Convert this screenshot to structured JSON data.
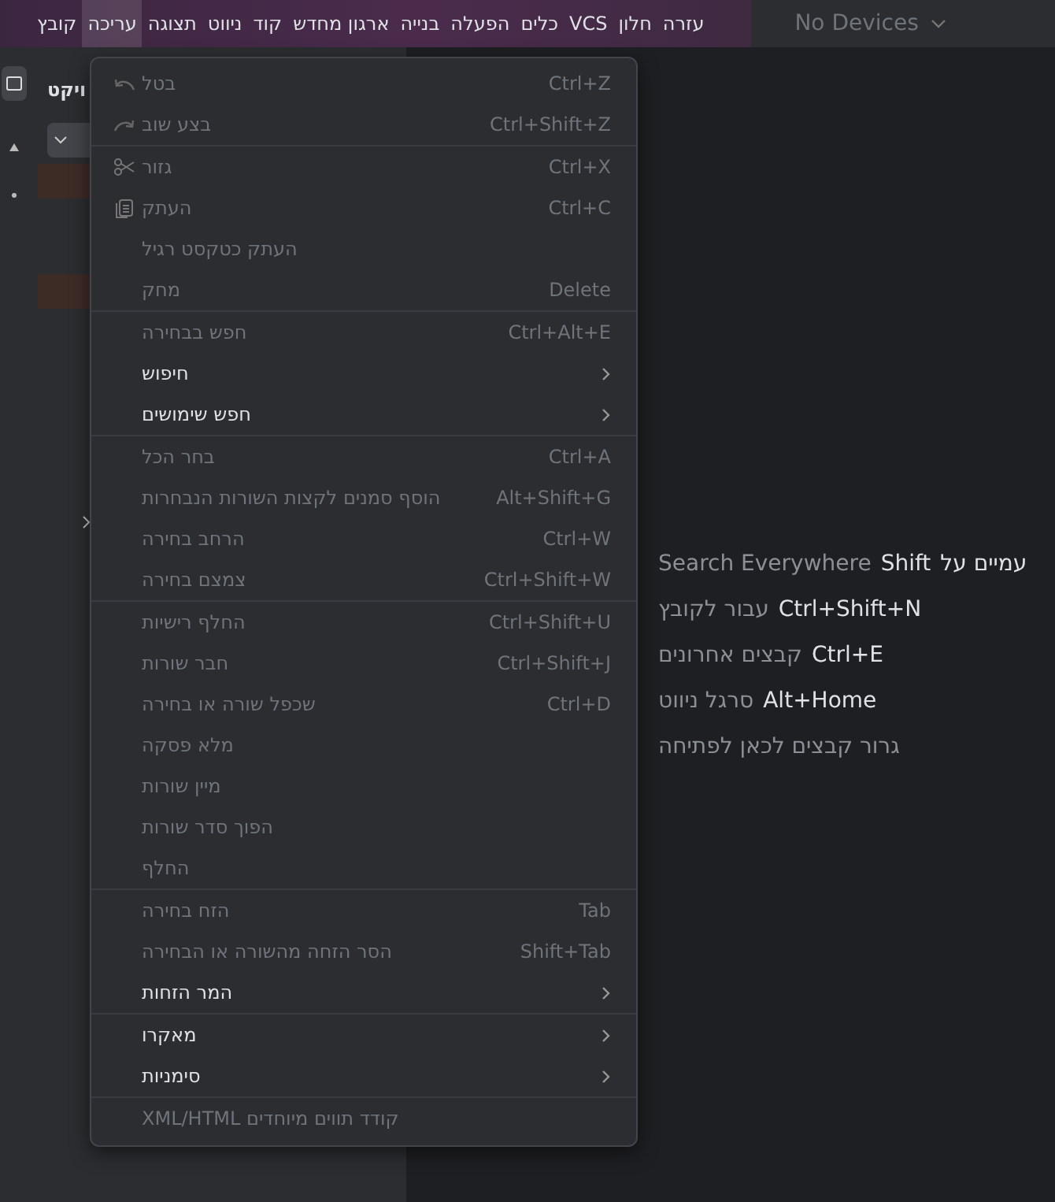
{
  "menu_bar": {
    "items": [
      {
        "label": "עזרה",
        "selected": false
      },
      {
        "label": "חלון",
        "selected": false
      },
      {
        "label": "VCS",
        "selected": false
      },
      {
        "label": "כלים",
        "selected": false
      },
      {
        "label": "הפעלה",
        "selected": false
      },
      {
        "label": "בנייה",
        "selected": false
      },
      {
        "label": "ארגון מחדש",
        "selected": false
      },
      {
        "label": "קוד",
        "selected": false
      },
      {
        "label": "ניווט",
        "selected": false
      },
      {
        "label": "תצוגה",
        "selected": false
      },
      {
        "label": "עריכה",
        "selected": true
      },
      {
        "label": "קובץ",
        "selected": false
      }
    ],
    "device_selector": {
      "label": "No Devices"
    }
  },
  "project_panel": {
    "title": "ויקט"
  },
  "edit_menu": {
    "items": [
      {
        "kind": "item",
        "label": "בטל",
        "shortcut": "Ctrl+Z",
        "disabled": true
      },
      {
        "kind": "item",
        "label": "בצע שוב",
        "shortcut": "Ctrl+Shift+Z",
        "disabled": true
      },
      {
        "kind": "separator"
      },
      {
        "kind": "item",
        "label": "גזור",
        "shortcut": "Ctrl+X",
        "disabled": true
      },
      {
        "kind": "item",
        "label": "העתק",
        "shortcut": "Ctrl+C",
        "disabled": true
      },
      {
        "kind": "item",
        "label": "העתק כטקסט רגיל",
        "disabled": true
      },
      {
        "kind": "item",
        "label": "מחק",
        "shortcut": "Delete",
        "disabled": true
      },
      {
        "kind": "separator"
      },
      {
        "kind": "item",
        "label": "חפש בבחירה",
        "shortcut": "Ctrl+Alt+E",
        "disabled": true
      },
      {
        "kind": "submenu",
        "label": "חיפוש",
        "disabled": false
      },
      {
        "kind": "submenu",
        "label": "חפש שימושים",
        "disabled": false
      },
      {
        "kind": "separator"
      },
      {
        "kind": "item",
        "label": "בחר הכל",
        "shortcut": "Ctrl+A",
        "disabled": true
      },
      {
        "kind": "item",
        "label": "הוסף סמנים לקצות השורות הנבחרות",
        "shortcut": "Alt+Shift+G",
        "disabled": true
      },
      {
        "kind": "item",
        "label": "הרחב בחירה",
        "shortcut": "Ctrl+W",
        "disabled": true
      },
      {
        "kind": "item",
        "label": "צמצם בחירה",
        "shortcut": "Ctrl+Shift+W",
        "disabled": true
      },
      {
        "kind": "separator"
      },
      {
        "kind": "item",
        "label": "החלף רישיות",
        "shortcut": "Ctrl+Shift+U",
        "disabled": true
      },
      {
        "kind": "item",
        "label": "חבר שורות",
        "shortcut": "Ctrl+Shift+J",
        "disabled": true
      },
      {
        "kind": "item",
        "label": "שכפל שורה או בחירה",
        "shortcut": "Ctrl+D",
        "disabled": true
      },
      {
        "kind": "item",
        "label": "מלא פסקה",
        "disabled": true
      },
      {
        "kind": "item",
        "label": "מיין שורות",
        "disabled": true
      },
      {
        "kind": "item",
        "label": "הפוך סדר שורות",
        "disabled": true
      },
      {
        "kind": "item",
        "label": "החלף",
        "disabled": true
      },
      {
        "kind": "separator"
      },
      {
        "kind": "item",
        "label": "הזח בחירה",
        "shortcut": "Tab",
        "disabled": true
      },
      {
        "kind": "item",
        "label": "הסר הזחה מהשורה או הבחירה",
        "shortcut": "Shift+Tab",
        "disabled": true
      },
      {
        "kind": "submenu",
        "label": "המר הזחות",
        "disabled": false
      },
      {
        "kind": "separator"
      },
      {
        "kind": "submenu",
        "label": "מאקרו",
        "disabled": false
      },
      {
        "kind": "submenu",
        "label": "סימניות",
        "disabled": false
      },
      {
        "kind": "separator"
      },
      {
        "kind": "item",
        "label": "קודד תווים מיוחדים XML/HTML",
        "disabled": true
      }
    ]
  },
  "welcome_hints": [
    {
      "label": "Search Everywhere",
      "keys": "Shift",
      "suffix": "עמיים על"
    },
    {
      "label": "עבור לקובץ",
      "keys": "Ctrl+Shift+N"
    },
    {
      "label": "קבצים אחרונים",
      "keys": "Ctrl+E"
    },
    {
      "label": "סרגל ניווט",
      "keys": "Alt+Home"
    },
    {
      "label": "גרור קבצים לכאן לפתיחה"
    }
  ]
}
